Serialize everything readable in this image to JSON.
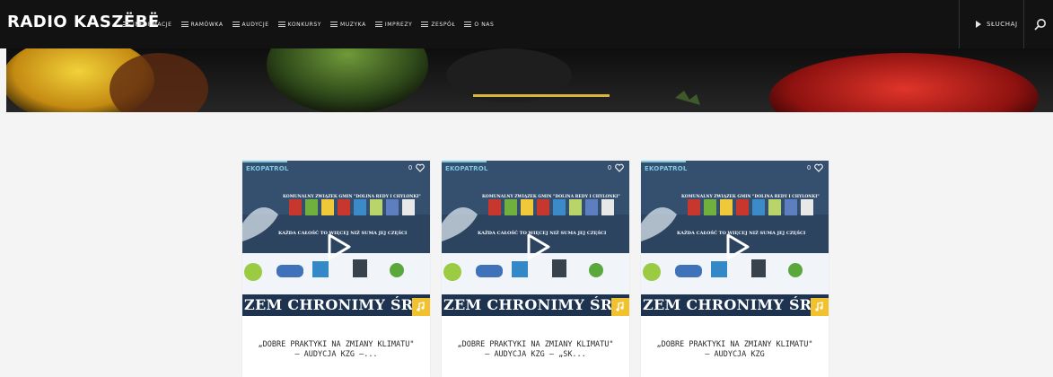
{
  "header": {
    "logo": "RADIO KASZËBË",
    "nav": [
      {
        "label": "INFORMACJE"
      },
      {
        "label": "RAMÓWKA"
      },
      {
        "label": "AUDYCJE"
      },
      {
        "label": "KONKURSY"
      },
      {
        "label": "MUZYKA"
      },
      {
        "label": "IMPREZY"
      },
      {
        "label": "ZESPÓŁ"
      },
      {
        "label": "O NAS"
      }
    ],
    "listen_label": "SŁUCHAJ"
  },
  "colors": {
    "topbar": "#121212",
    "accent_yellow": "#f2c12e",
    "category_blue": "#7ec8e3"
  },
  "cards": [
    {
      "category": "EKOPATROL",
      "likes": "0",
      "image_top_text": "KOMUNALNY ZWIĄZEK GMIN \"DOLINA REDY I CHYLONKI\"",
      "image_tagline": "KAŻDA CAŁOŚĆ TO WIĘCEJ NIŻ SUMA JEJ CZĘŚCI",
      "image_bottom_text": "ZEM CHRONIMY ŚRODOWISKO",
      "title": "„DOBRE PRAKTYKI NA ZMIANY KLIMATU\" – AUDYCJA KZG –..."
    },
    {
      "category": "EKOPATROL",
      "likes": "0",
      "image_top_text": "KOMUNALNY ZWIĄZEK GMIN \"DOLINA REDY I CHYLONKI\"",
      "image_tagline": "KAŻDA CAŁOŚĆ TO WIĘCEJ NIŻ SUMA JEJ CZĘŚCI",
      "image_bottom_text": "ZEM CHRONIMY ŚRODOWISKO",
      "title": "„DOBRE PRAKTYKI NA ZMIANY KLIMATU\" – AUDYCJA KZG – „SK..."
    },
    {
      "category": "EKOPATROL",
      "likes": "0",
      "image_top_text": "KOMUNALNY ZWIĄZEK GMIN \"DOLINA REDY I CHYLONKI\"",
      "image_tagline": "KAŻDA CAŁOŚĆ TO WIĘCEJ NIŻ SUMA JEJ CZĘŚCI",
      "image_bottom_text": "ZEM CHRONIMY ŚRODOWISKO",
      "title": "„DOBRE PRAKTYKI NA ZMIANY KLIMATU\" – AUDYCJA KZG"
    }
  ]
}
